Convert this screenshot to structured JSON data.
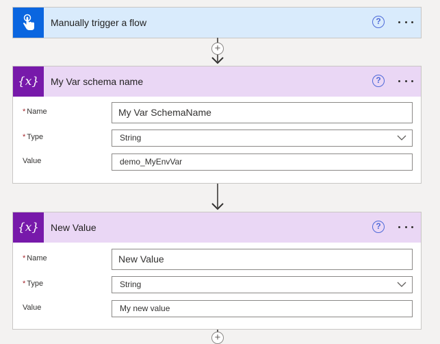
{
  "trigger": {
    "title": "Manually trigger a flow",
    "icon": "hand-touch-icon",
    "help_glyph": "?"
  },
  "var_card_1": {
    "title": "My Var schema name",
    "icon": "variable-icon",
    "icon_glyph": "{x}",
    "help_glyph": "?",
    "fields": {
      "name": {
        "label": "Name",
        "value": "My Var SchemaName"
      },
      "type": {
        "label": "Type",
        "value": "String"
      },
      "value": {
        "label": "Value",
        "value": "demo_MyEnvVar"
      }
    }
  },
  "var_card_2": {
    "title": "New Value",
    "icon": "variable-icon",
    "icon_glyph": "{x}",
    "help_glyph": "?",
    "fields": {
      "name": {
        "label": "Name",
        "value": "New Value"
      },
      "type": {
        "label": "Type",
        "value": "String"
      },
      "value": {
        "label": "Value",
        "value": "My new value"
      }
    }
  },
  "required_marker": "*",
  "add_step_glyph": "+",
  "colors": {
    "trigger_accent": "#0a66e0",
    "trigger_header": "#d9ebfc",
    "variable_accent": "#7719aa",
    "variable_header": "#ead7f5",
    "required": "#a4262c"
  }
}
